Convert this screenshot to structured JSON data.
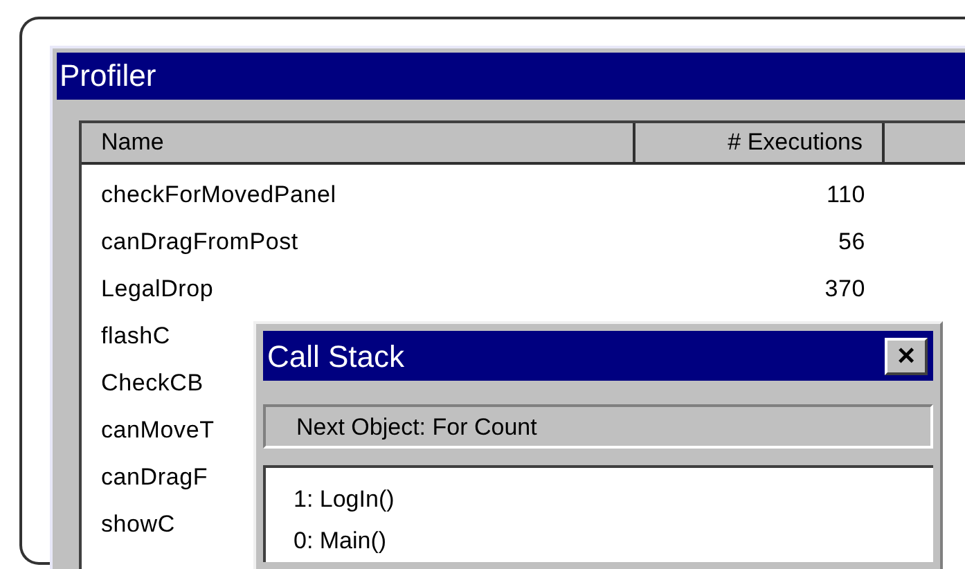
{
  "window": {
    "title": "Profiler"
  },
  "table": {
    "columns": [
      "Name",
      "# Executions"
    ],
    "rows": [
      {
        "name": "checkForMovedPanel",
        "executions": "110"
      },
      {
        "name": "canDragFromPost",
        "executions": "56"
      },
      {
        "name": "LegalDrop",
        "executions": "370"
      },
      {
        "name": "flashC"
      },
      {
        "name": "CheckCB"
      },
      {
        "name": "canMoveT"
      },
      {
        "name": "canDragF"
      },
      {
        "name": "showC"
      }
    ]
  },
  "dialog": {
    "title": "Call Stack",
    "close": "×",
    "next_object": "Next Object:  For Count",
    "stack": [
      "1:  LogIn()",
      "0:  Main()"
    ]
  }
}
